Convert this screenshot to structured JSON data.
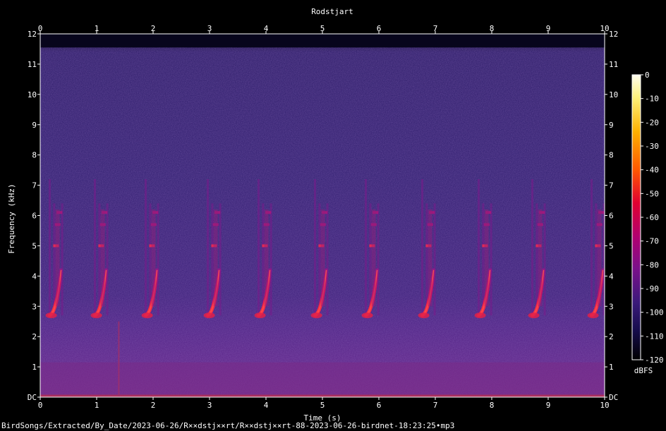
{
  "chart_data": {
    "type": "heatmap",
    "title": "Rodstjart",
    "xlabel": "Time (s)",
    "ylabel": "Frequency (kHz)",
    "xlim": [
      0,
      10
    ],
    "ylim": [
      0,
      12
    ],
    "x_ticks": [
      "0",
      "1",
      "2",
      "3",
      "4",
      "5",
      "6",
      "7",
      "8",
      "9",
      "10"
    ],
    "y_ticks": [
      "DC",
      "1",
      "2",
      "3",
      "4",
      "5",
      "6",
      "7",
      "8",
      "9",
      "10",
      "11",
      "12"
    ],
    "colorbar": {
      "label": "dBFS",
      "ticks": [
        "0",
        "-10",
        "-20",
        "-30",
        "-40",
        "-50",
        "-60",
        "-70",
        "-80",
        "-90",
        "-100",
        "-110",
        "-120"
      ],
      "range": [
        -120,
        0
      ]
    },
    "song_phrases": {
      "description_units": "time in s, frequency in kHz",
      "start_times": [
        0.15,
        0.95,
        1.85,
        2.95,
        3.85,
        4.85,
        5.75,
        6.75,
        7.75,
        8.7,
        9.75
      ],
      "sweep_low_khz": 2.7,
      "sweep_high_khz": 4.2,
      "upper_notes_khz": [
        5.0,
        5.7,
        6.1
      ]
    }
  },
  "footer": {
    "path": "BirdSongs/Extracted/By_Date/2023-06-26/R××dstj××rt/R××dstj××rt-88-2023-06-26-birdnet-18:23:25•mp3"
  }
}
